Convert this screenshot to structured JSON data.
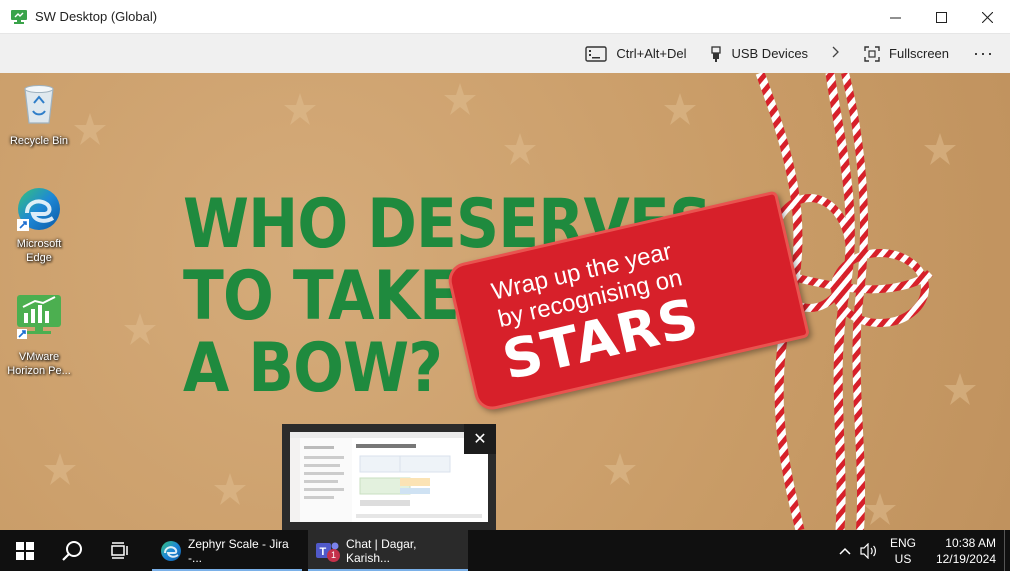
{
  "window": {
    "title": "SW Desktop (Global)"
  },
  "window_controls": {
    "minimize": "—",
    "maximize": "☐",
    "close": "✕"
  },
  "toolbar": {
    "ctrl_alt_del": "Ctrl+Alt+Del",
    "usb_devices": "USB Devices",
    "fullscreen": "Fullscreen",
    "more": "···"
  },
  "desktop_icons": [
    {
      "label": "Recycle Bin",
      "icon": "recycle-bin-icon"
    },
    {
      "label": "Microsoft Edge",
      "icon": "edge-icon"
    },
    {
      "label": "VMware Horizon Pe...",
      "icon": "vmware-horizon-icon"
    }
  ],
  "wallpaper": {
    "headline_line1": "WHO DESERVES",
    "headline_line2": "TO TAKE",
    "headline_line3": "A BOW?",
    "tag_line1": "Wrap up the year",
    "tag_line2": "by recognising on",
    "tag_brand": "STARS"
  },
  "taskbar": {
    "apps": [
      {
        "label": "Zephyr Scale - Jira -...",
        "icon": "edge-icon"
      },
      {
        "label": "Chat | Dagar, Karish...",
        "icon": "teams-icon",
        "badge": "1"
      }
    ],
    "language": "ENG",
    "region": "US",
    "time": "10:38 AM",
    "date": "12/19/2024"
  },
  "preview": {
    "close": "✕"
  },
  "colors": {
    "accent": "#1f8a3e",
    "tag": "#d7202a",
    "taskbar": "#101010"
  }
}
